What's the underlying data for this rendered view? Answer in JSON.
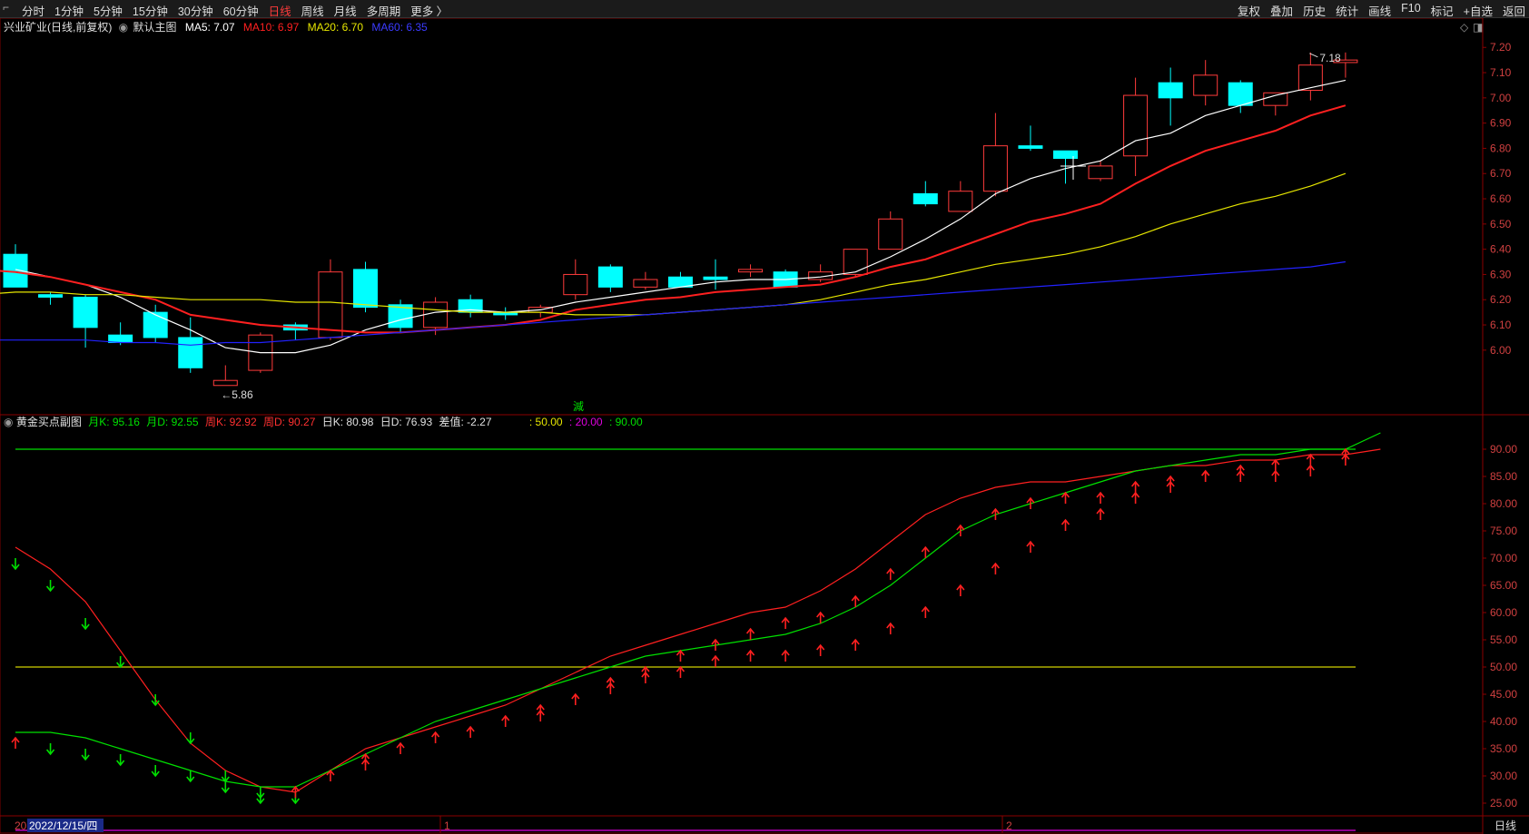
{
  "toolbar": {
    "periods": [
      "分时",
      "1分钟",
      "5分钟",
      "15分钟",
      "30分钟",
      "60分钟",
      "日线",
      "周线",
      "月线",
      "多周期",
      "更多 〉"
    ],
    "active_period": "日线",
    "right_tools": [
      "复权",
      "叠加",
      "历史",
      "统计",
      "画线",
      "F10",
      "标记",
      "+自选",
      "返回"
    ]
  },
  "main_legend": {
    "stock": "兴业矿业(日线,前复权)",
    "template": "默认主图",
    "ma5": "MA5: 7.07",
    "ma10": "MA10: 6.97",
    "ma20": "MA20: 6.70",
    "ma60": "MA60: 6.35"
  },
  "sub_legend": {
    "name": "黄金买点副图",
    "monthK": "月K: 95.16",
    "monthD": "月D: 92.55",
    "weekK": "周K: 92.92",
    "weekD": "周D: 90.27",
    "dayK": "日K: 80.98",
    "dayD": "日D: 76.93",
    "diff": "差值: -2.27",
    "ref50": ": 50.00",
    "ref20": ": 20.00",
    "ref90": ": 90.00"
  },
  "annotations": {
    "high": "7.18",
    "low": "5.86",
    "mid_marker": "減"
  },
  "bottom_axis": {
    "first_label": "20",
    "cursor_date": "2022/12/15/四",
    "m1": "1",
    "m2": "2",
    "period": "日线"
  },
  "colors": {
    "up": "#ff3b3b",
    "down": "#00ffff",
    "ma5": "#ffffff",
    "ma10": "#ff2020",
    "ma20": "#e6e600",
    "ma60": "#2222ff",
    "green": "#00e000",
    "magenta": "#e000e0",
    "yellow": "#d0d000"
  },
  "chart_data": [
    {
      "type": "candlestick",
      "title": "兴业矿业(日线,前复权)",
      "ylim": [
        5.78,
        7.28
      ],
      "yticks": [
        6.0,
        6.1,
        6.2,
        6.3,
        6.4,
        6.5,
        6.6,
        6.7,
        6.8,
        6.9,
        7.0,
        7.1,
        7.2
      ],
      "candles": [
        {
          "o": 6.38,
          "h": 6.42,
          "l": 6.25,
          "c": 6.25
        },
        {
          "o": 6.22,
          "h": 6.23,
          "l": 6.18,
          "c": 6.21
        },
        {
          "o": 6.21,
          "h": 6.22,
          "l": 6.01,
          "c": 6.09
        },
        {
          "o": 6.06,
          "h": 6.11,
          "l": 6.02,
          "c": 6.03
        },
        {
          "o": 6.15,
          "h": 6.18,
          "l": 6.03,
          "c": 6.05
        },
        {
          "o": 6.05,
          "h": 6.13,
          "l": 5.91,
          "c": 5.93
        },
        {
          "o": 5.86,
          "h": 5.94,
          "l": 5.86,
          "c": 5.88
        },
        {
          "o": 5.92,
          "h": 6.07,
          "l": 5.91,
          "c": 6.06
        },
        {
          "o": 6.1,
          "h": 6.11,
          "l": 6.04,
          "c": 6.08
        },
        {
          "o": 6.05,
          "h": 6.36,
          "l": 6.04,
          "c": 6.31
        },
        {
          "o": 6.32,
          "h": 6.35,
          "l": 6.15,
          "c": 6.17
        },
        {
          "o": 6.18,
          "h": 6.2,
          "l": 6.07,
          "c": 6.09
        },
        {
          "o": 6.09,
          "h": 6.21,
          "l": 6.06,
          "c": 6.19
        },
        {
          "o": 6.2,
          "h": 6.22,
          "l": 6.13,
          "c": 6.15
        },
        {
          "o": 6.15,
          "h": 6.17,
          "l": 6.12,
          "c": 6.14
        },
        {
          "o": 6.15,
          "h": 6.18,
          "l": 6.13,
          "c": 6.17
        },
        {
          "o": 6.22,
          "h": 6.36,
          "l": 6.2,
          "c": 6.3
        },
        {
          "o": 6.33,
          "h": 6.34,
          "l": 6.23,
          "c": 6.25
        },
        {
          "o": 6.25,
          "h": 6.31,
          "l": 6.24,
          "c": 6.28
        },
        {
          "o": 6.29,
          "h": 6.31,
          "l": 6.25,
          "c": 6.25
        },
        {
          "o": 6.29,
          "h": 6.36,
          "l": 6.24,
          "c": 6.28
        },
        {
          "o": 6.31,
          "h": 6.34,
          "l": 6.29,
          "c": 6.32
        },
        {
          "o": 6.31,
          "h": 6.32,
          "l": 6.25,
          "c": 6.25
        },
        {
          "o": 6.28,
          "h": 6.34,
          "l": 6.27,
          "c": 6.31
        },
        {
          "o": 6.3,
          "h": 6.4,
          "l": 6.29,
          "c": 6.4
        },
        {
          "o": 6.4,
          "h": 6.55,
          "l": 6.4,
          "c": 6.52
        },
        {
          "o": 6.62,
          "h": 6.67,
          "l": 6.57,
          "c": 6.58
        },
        {
          "o": 6.55,
          "h": 6.67,
          "l": 6.55,
          "c": 6.63
        },
        {
          "o": 6.63,
          "h": 6.94,
          "l": 6.61,
          "c": 6.81
        },
        {
          "o": 6.81,
          "h": 6.89,
          "l": 6.79,
          "c": 6.8
        },
        {
          "o": 6.79,
          "h": 6.79,
          "l": 6.66,
          "c": 6.76
        },
        {
          "o": 6.68,
          "h": 6.75,
          "l": 6.67,
          "c": 6.73
        },
        {
          "o": 6.77,
          "h": 7.08,
          "l": 6.69,
          "c": 7.01
        },
        {
          "o": 7.06,
          "h": 7.12,
          "l": 6.89,
          "c": 7.0
        },
        {
          "o": 7.01,
          "h": 7.15,
          "l": 6.97,
          "c": 7.09
        },
        {
          "o": 7.06,
          "h": 7.07,
          "l": 6.94,
          "c": 6.97
        },
        {
          "o": 6.97,
          "h": 7.02,
          "l": 6.93,
          "c": 7.02
        },
        {
          "o": 7.03,
          "h": 7.18,
          "l": 6.99,
          "c": 7.13
        },
        {
          "o": 7.14,
          "h": 7.18,
          "l": 7.08,
          "c": 7.15
        }
      ],
      "series": [
        {
          "name": "MA5",
          "values": [
            6.32,
            6.29,
            6.26,
            6.21,
            6.14,
            6.08,
            6.01,
            5.99,
            5.99,
            6.02,
            6.08,
            6.12,
            6.15,
            6.16,
            6.15,
            6.16,
            6.19,
            6.21,
            6.23,
            6.25,
            6.27,
            6.28,
            6.28,
            6.29,
            6.31,
            6.37,
            6.44,
            6.52,
            6.62,
            6.68,
            6.72,
            6.75,
            6.83,
            6.86,
            6.93,
            6.97,
            7.01,
            7.04,
            7.07
          ]
        },
        {
          "name": "MA10",
          "values": [
            6.32,
            6.31,
            6.29,
            6.26,
            6.23,
            6.2,
            6.14,
            6.12,
            6.1,
            6.09,
            6.08,
            6.07,
            6.07,
            6.08,
            6.09,
            6.1,
            6.12,
            6.16,
            6.18,
            6.2,
            6.21,
            6.23,
            6.24,
            6.25,
            6.26,
            6.29,
            6.33,
            6.36,
            6.41,
            6.46,
            6.51,
            6.54,
            6.58,
            6.66,
            6.73,
            6.79,
            6.83,
            6.87,
            6.93,
            6.97
          ]
        },
        {
          "name": "MA20",
          "values": [
            6.22,
            6.23,
            6.23,
            6.22,
            6.22,
            6.21,
            6.2,
            6.2,
            6.2,
            6.19,
            6.19,
            6.18,
            6.17,
            6.16,
            6.15,
            6.15,
            6.15,
            6.14,
            6.14,
            6.14,
            6.15,
            6.16,
            6.17,
            6.18,
            6.2,
            6.23,
            6.26,
            6.28,
            6.31,
            6.34,
            6.36,
            6.38,
            6.41,
            6.45,
            6.5,
            6.54,
            6.58,
            6.61,
            6.65,
            6.7
          ]
        },
        {
          "name": "MA60",
          "values": [
            6.04,
            6.04,
            6.04,
            6.04,
            6.03,
            6.03,
            6.02,
            6.03,
            6.03,
            6.04,
            6.05,
            6.06,
            6.07,
            6.08,
            6.09,
            6.1,
            6.11,
            6.12,
            6.13,
            6.14,
            6.15,
            6.16,
            6.17,
            6.18,
            6.19,
            6.2,
            6.21,
            6.22,
            6.23,
            6.24,
            6.25,
            6.26,
            6.27,
            6.28,
            6.29,
            6.3,
            6.31,
            6.32,
            6.33,
            6.35
          ]
        }
      ]
    },
    {
      "type": "line",
      "title": "黄金买点副图",
      "ylim": [
        20,
        95
      ],
      "yticks": [
        25,
        30,
        35,
        40,
        45,
        50,
        55,
        60,
        65,
        70,
        75,
        80,
        85,
        90
      ],
      "reference_lines": [
        90,
        50,
        20
      ],
      "series": [
        {
          "name": "周K",
          "values": [
            72,
            68,
            62,
            53,
            44,
            36,
            31,
            28,
            27,
            31,
            35,
            37,
            39,
            41,
            43,
            46,
            49,
            52,
            54,
            56,
            58,
            60,
            61,
            64,
            68,
            73,
            78,
            81,
            83,
            84,
            84,
            85,
            86,
            87,
            87,
            88,
            88,
            89,
            89,
            90
          ]
        },
        {
          "name": "周D",
          "values": [
            38,
            38,
            37,
            35,
            33,
            31,
            29,
            28,
            28,
            31,
            34,
            37,
            40,
            42,
            44,
            46,
            48,
            50,
            52,
            53,
            54,
            55,
            56,
            58,
            61,
            65,
            70,
            75,
            78,
            80,
            82,
            84,
            86,
            87,
            88,
            89,
            89,
            90,
            90,
            93
          ]
        }
      ],
      "arrows": [
        {
          "day": 0,
          "dir": "down",
          "y": 69
        },
        {
          "day": 0,
          "dir": "up",
          "y": 36
        },
        {
          "day": 1,
          "dir": "down",
          "y": 65
        },
        {
          "day": 1,
          "dir": "down",
          "y": 35
        },
        {
          "day": 2,
          "dir": "down",
          "y": 58
        },
        {
          "day": 2,
          "dir": "down",
          "y": 34
        },
        {
          "day": 3,
          "dir": "down",
          "y": 51
        },
        {
          "day": 3,
          "dir": "down",
          "y": 33
        },
        {
          "day": 4,
          "dir": "down",
          "y": 44
        },
        {
          "day": 4,
          "dir": "down",
          "y": 31
        },
        {
          "day": 5,
          "dir": "down",
          "y": 37
        },
        {
          "day": 5,
          "dir": "down",
          "y": 30
        },
        {
          "day": 6,
          "dir": "down",
          "y": 30
        },
        {
          "day": 6,
          "dir": "down",
          "y": 28
        },
        {
          "day": 7,
          "dir": "down",
          "y": 27
        },
        {
          "day": 7,
          "dir": "down",
          "y": 26
        },
        {
          "day": 8,
          "dir": "down",
          "y": 26
        },
        {
          "day": 8,
          "dir": "up",
          "y": 27
        },
        {
          "day": 9,
          "dir": "up",
          "y": 30
        },
        {
          "day": 10,
          "dir": "up",
          "y": 33
        },
        {
          "day": 10,
          "dir": "up",
          "y": 32
        },
        {
          "day": 11,
          "dir": "up",
          "y": 35
        },
        {
          "day": 12,
          "dir": "up",
          "y": 37
        },
        {
          "day": 13,
          "dir": "up",
          "y": 38
        },
        {
          "day": 14,
          "dir": "up",
          "y": 40
        },
        {
          "day": 15,
          "dir": "up",
          "y": 42
        },
        {
          "day": 15,
          "dir": "up",
          "y": 41
        },
        {
          "day": 16,
          "dir": "up",
          "y": 44
        },
        {
          "day": 17,
          "dir": "up",
          "y": 47
        },
        {
          "day": 17,
          "dir": "up",
          "y": 46
        },
        {
          "day": 18,
          "dir": "up",
          "y": 49
        },
        {
          "day": 18,
          "dir": "up",
          "y": 48
        },
        {
          "day": 19,
          "dir": "up",
          "y": 52
        },
        {
          "day": 19,
          "dir": "up",
          "y": 49
        },
        {
          "day": 20,
          "dir": "up",
          "y": 54
        },
        {
          "day": 20,
          "dir": "up",
          "y": 51
        },
        {
          "day": 21,
          "dir": "up",
          "y": 56
        },
        {
          "day": 21,
          "dir": "up",
          "y": 52
        },
        {
          "day": 22,
          "dir": "up",
          "y": 58
        },
        {
          "day": 22,
          "dir": "up",
          "y": 52
        },
        {
          "day": 23,
          "dir": "up",
          "y": 59
        },
        {
          "day": 23,
          "dir": "up",
          "y": 53
        },
        {
          "day": 24,
          "dir": "up",
          "y": 62
        },
        {
          "day": 24,
          "dir": "up",
          "y": 54
        },
        {
          "day": 25,
          "dir": "up",
          "y": 67
        },
        {
          "day": 25,
          "dir": "up",
          "y": 57
        },
        {
          "day": 26,
          "dir": "up",
          "y": 71
        },
        {
          "day": 26,
          "dir": "up",
          "y": 60
        },
        {
          "day": 27,
          "dir": "up",
          "y": 75
        },
        {
          "day": 27,
          "dir": "up",
          "y": 64
        },
        {
          "day": 28,
          "dir": "up",
          "y": 78
        },
        {
          "day": 28,
          "dir": "up",
          "y": 68
        },
        {
          "day": 29,
          "dir": "up",
          "y": 80
        },
        {
          "day": 29,
          "dir": "up",
          "y": 72
        },
        {
          "day": 30,
          "dir": "up",
          "y": 81
        },
        {
          "day": 30,
          "dir": "up",
          "y": 76
        },
        {
          "day": 31,
          "dir": "up",
          "y": 81
        },
        {
          "day": 31,
          "dir": "up",
          "y": 78
        },
        {
          "day": 32,
          "dir": "up",
          "y": 83
        },
        {
          "day": 32,
          "dir": "up",
          "y": 81
        },
        {
          "day": 33,
          "dir": "up",
          "y": 84
        },
        {
          "day": 33,
          "dir": "up",
          "y": 83
        },
        {
          "day": 34,
          "dir": "up",
          "y": 85
        },
        {
          "day": 34,
          "dir": "up",
          "y": 85
        },
        {
          "day": 35,
          "dir": "up",
          "y": 86
        },
        {
          "day": 35,
          "dir": "up",
          "y": 85
        },
        {
          "day": 36,
          "dir": "up",
          "y": 87
        },
        {
          "day": 36,
          "dir": "up",
          "y": 85
        },
        {
          "day": 37,
          "dir": "up",
          "y": 88
        },
        {
          "day": 37,
          "dir": "up",
          "y": 86
        },
        {
          "day": 38,
          "dir": "up",
          "y": 89
        },
        {
          "day": 38,
          "dir": "up",
          "y": 88
        }
      ]
    }
  ]
}
